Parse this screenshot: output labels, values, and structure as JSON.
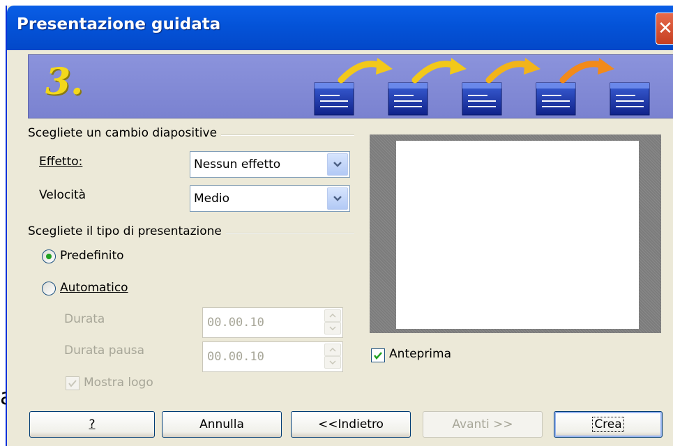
{
  "window": {
    "title": "Presentazione guidata",
    "close_glyph": "✕"
  },
  "banner": {
    "step": "3.",
    "icons": [
      "slide-icon",
      "slide-icon",
      "slide-icon",
      "slide-icon",
      "slide-icon"
    ],
    "arrow_colors": [
      "#f2c81a",
      "#f2c81a",
      "#f2b41a",
      "#f28a1a"
    ]
  },
  "transition_group": {
    "label": "Scegliete un cambio diapositive",
    "effect_label": "Effetto:",
    "effect_value": "Nessun effetto",
    "speed_label": "Velocità",
    "speed_value": "Medio"
  },
  "type_group": {
    "label": "Scegliete il tipo di presentazione",
    "predefinito_label": "Predefinito",
    "predefinito_selected": true,
    "automatico_label": "Automatico",
    "automatico_selected": false,
    "durata_label": "Durata",
    "durata_value": "00.00.10",
    "durata_pausa_label": "Durata pausa",
    "durata_pausa_value": "00.00.10",
    "mostra_logo_label": "Mostra logo",
    "mostra_logo_checked": true
  },
  "preview": {
    "anteprima_label": "Anteprima",
    "anteprima_checked": true
  },
  "buttons": {
    "help": "?",
    "cancel": "Annulla",
    "back": "<<Indietro",
    "next": "Avanti >>",
    "create": "Crea"
  },
  "background_text": "a",
  "colors": {
    "titlebar": "#0453d8",
    "dialog_bg": "#ece9d8",
    "banner": "#7a82d0",
    "radio_dot": "#21a121"
  }
}
